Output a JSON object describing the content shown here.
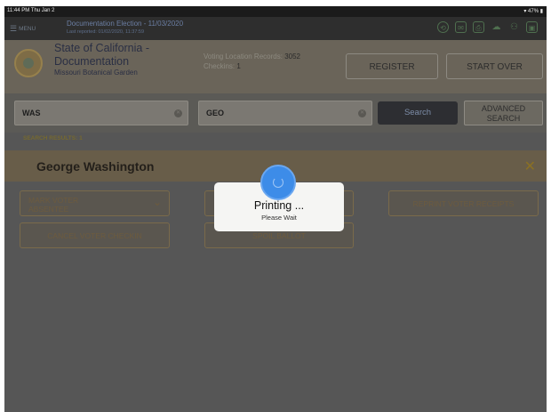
{
  "status_bar": {
    "time": "11:44 PM  Thu Jan 2",
    "battery": "47%"
  },
  "nav": {
    "menu_label": "MENU",
    "election_title": "Documentation Election - 11/03/2020",
    "last_reported": "Last reported: 01/02/2020, 11:37:59"
  },
  "header": {
    "org_line1": "State of California -",
    "org_line2": "Documentation",
    "location": "Missouri Botanical Garden",
    "records_label": "Voting Location Records:",
    "records_value": "3052",
    "checkins_label": "Checkins:",
    "checkins_value": "1",
    "register_label": "REGISTER",
    "start_over_label": "START OVER"
  },
  "search": {
    "last_name_value": "WAS",
    "first_name_value": "GEO",
    "search_label": "Search",
    "advanced_line1": "ADVANCED",
    "advanced_line2": "SEARCH"
  },
  "results": {
    "label": "SEARCH RESULTS: 1",
    "voter_name": "George  Washington"
  },
  "actions": {
    "mark_absentee_line1": "MARK VOTER",
    "mark_absentee_line2": "ABSENTEE",
    "cancel_checkin": "CANCEL VOTER CHECKIN",
    "spoil_ballot": "SPOIL BALLOT",
    "reprint_receipts": "REPRINT VOTER RECEIPTS"
  },
  "modal": {
    "title": "Printing ...",
    "subtitle": "Please Wait"
  }
}
